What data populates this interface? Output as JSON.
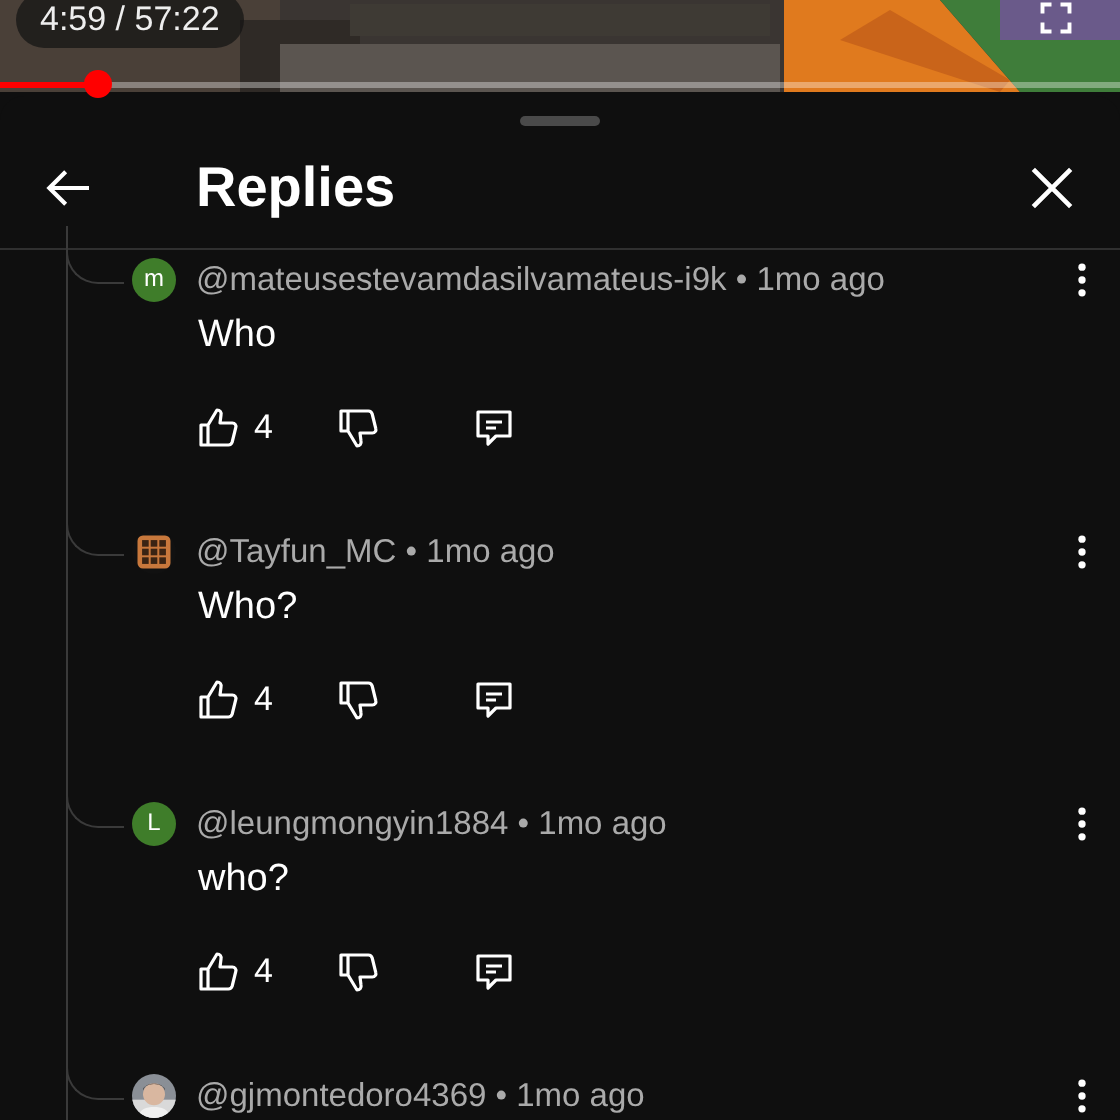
{
  "player": {
    "time": "4:59 / 57:22",
    "progress": {
      "level": 0.087
    }
  },
  "header": {
    "title": "Replies"
  },
  "comments": [
    {
      "avatar": {
        "kind": "letter",
        "letter": "m",
        "color": "#3f7d2a"
      },
      "meta": "@mateusestevamdasilvamateus-i9k • 1mo ago",
      "text": "Who",
      "likes": "4"
    },
    {
      "avatar": {
        "kind": "grid",
        "color": "#c8783c"
      },
      "meta": "@Tayfun_MC • 1mo ago",
      "text": "Who?",
      "likes": "4"
    },
    {
      "avatar": {
        "kind": "letter",
        "letter": "L",
        "color": "#3f7d2a"
      },
      "meta": "@leungmongyin1884 • 1mo ago",
      "text": "who?",
      "likes": "4"
    },
    {
      "meta": "@gjmontedoro4369 • 1mo ago"
    }
  ]
}
